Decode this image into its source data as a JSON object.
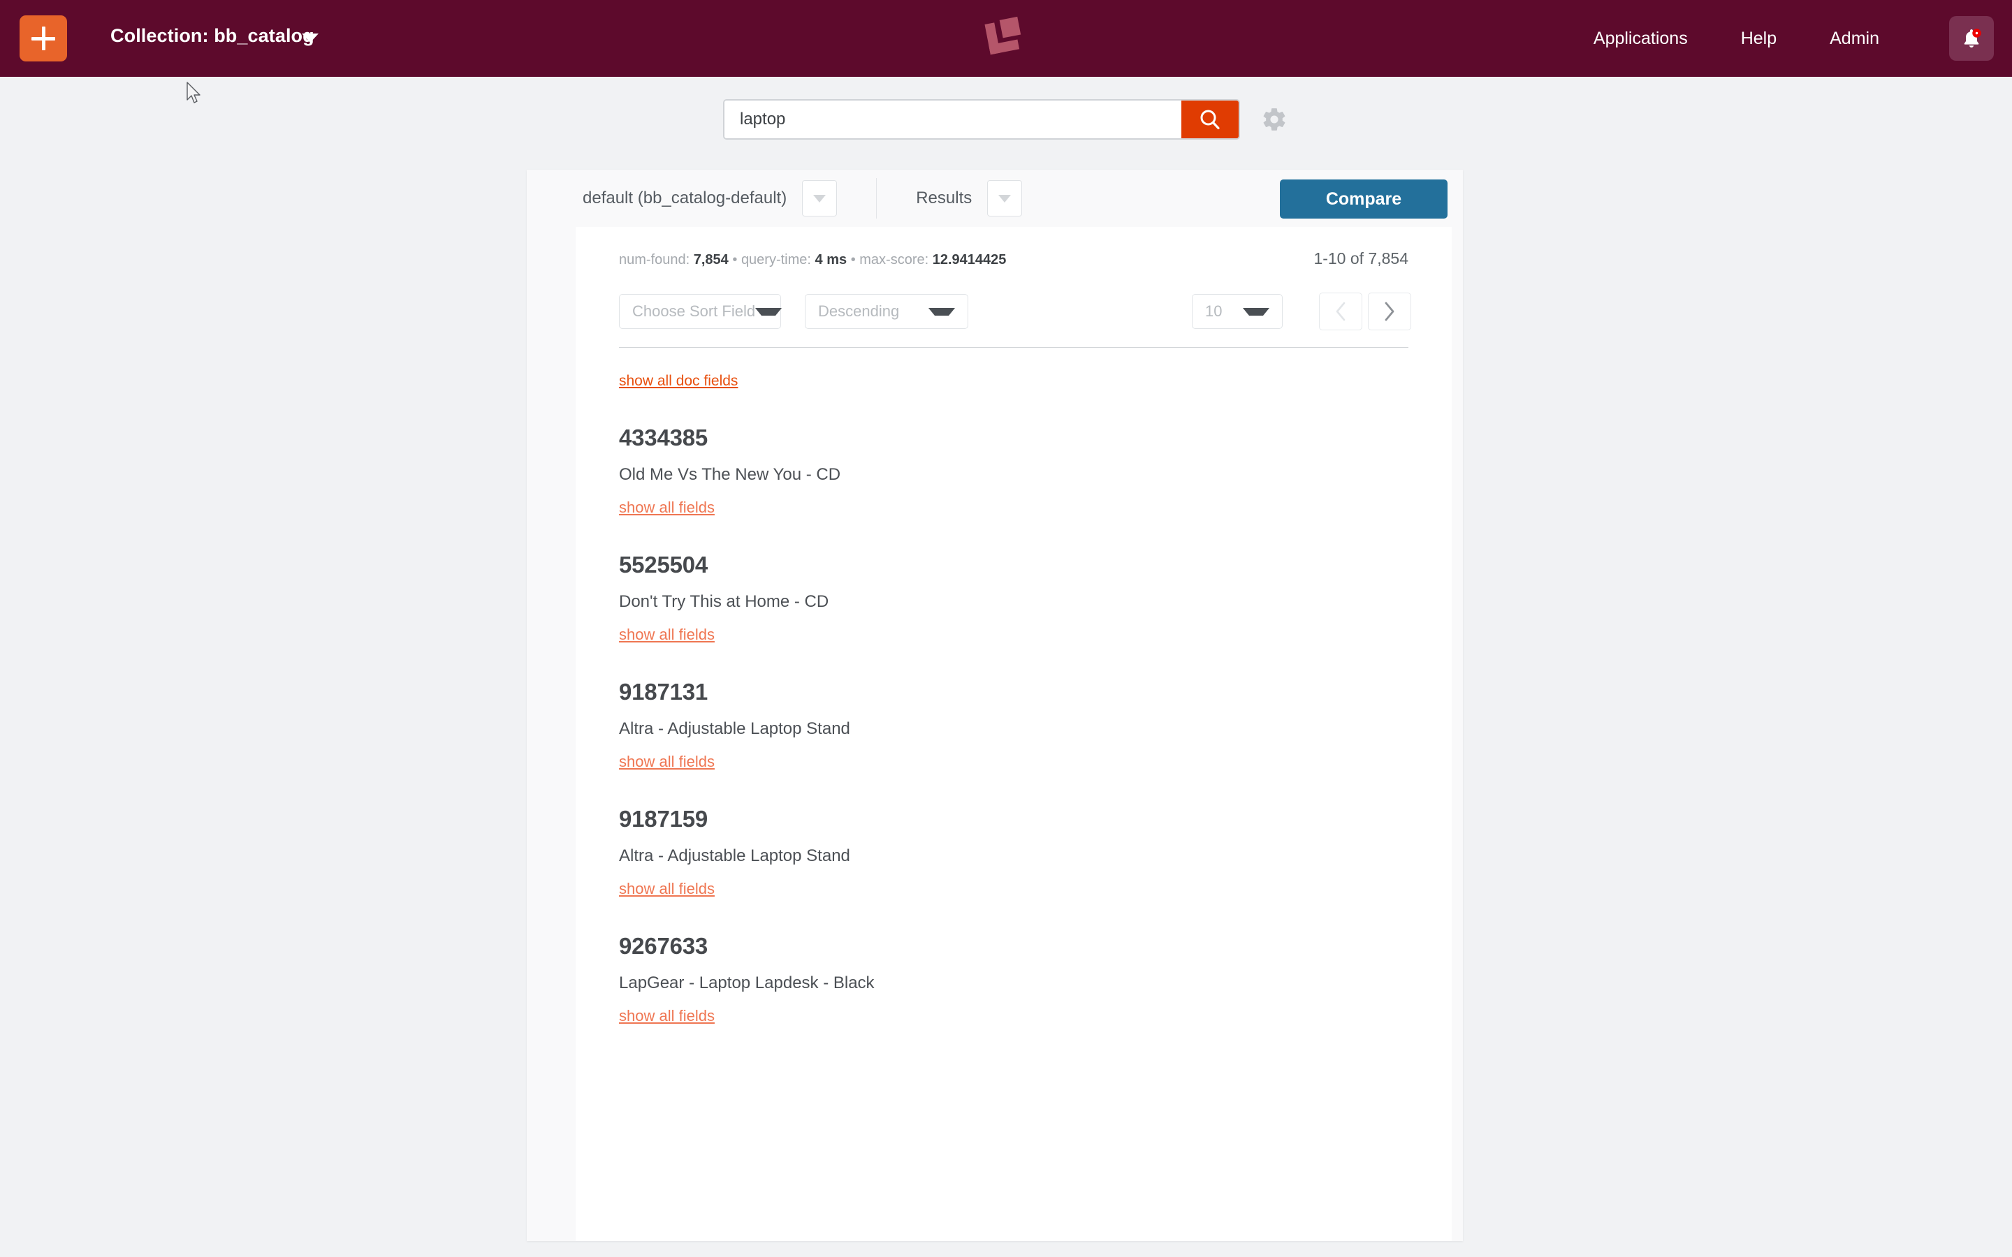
{
  "topbar": {
    "add_button_label": "+",
    "collection_label": "Collection: bb_catalog",
    "logo_name": "lucidworks-fusion-logo",
    "nav": [
      {
        "label": "Applications"
      },
      {
        "label": "Help"
      },
      {
        "label": "Admin"
      }
    ],
    "notification": {
      "icon": "bell-icon",
      "has_badge": true,
      "badge_color": "#ee0000"
    },
    "background_color": "#5d0a2c",
    "accent_color": "#e8642a"
  },
  "search": {
    "value": "laptop",
    "placeholder": "Search",
    "button_icon": "search-icon",
    "button_color": "#e03c02",
    "settings_icon": "gear-icon"
  },
  "panel": {
    "query_profile": "default (bb_catalog-default)",
    "query_profile_caret": "chevron-down-icon",
    "view_label": "Results",
    "view_caret": "chevron-down-icon",
    "compare_label": "Compare",
    "compare_color": "#23709b"
  },
  "stats": {
    "num_found_label": "num-found:",
    "num_found_value": "7,854",
    "sep1": "•",
    "query_time_label": "query-time:",
    "query_time_value": "4 ms",
    "sep2": "•",
    "max_score_label": "max-score:",
    "max_score_value": "12.9414425",
    "range": "1-10 of 7,854"
  },
  "controls": {
    "sort_field": "Choose Sort Field",
    "sort_direction": "Descending",
    "rows_per_page": "10",
    "prev_icon": "chevron-left-icon",
    "next_icon": "chevron-right-icon",
    "prev_enabled": false,
    "next_enabled": true
  },
  "links": {
    "show_all_doc_fields": "show all doc fields",
    "show_all_fields": "show all fields"
  },
  "results": [
    {
      "id": "4334385",
      "title": "Old Me Vs The New You - CD",
      "link": "show all fields"
    },
    {
      "id": "5525504",
      "title": "Don't Try This at Home - CD",
      "link": "show all fields"
    },
    {
      "id": "9187131",
      "title": "Altra - Adjustable Laptop Stand",
      "link": "show all fields"
    },
    {
      "id": "9187159",
      "title": "Altra - Adjustable Laptop Stand",
      "link": "show all fields"
    },
    {
      "id": "9267633",
      "title": "LapGear - Laptop Lapdesk - Black",
      "link": "show all fields"
    }
  ],
  "cursor": {
    "icon": "mouse-pointer-icon"
  }
}
